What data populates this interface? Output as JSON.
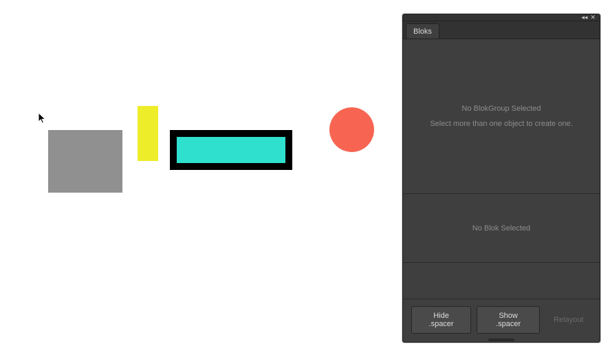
{
  "panel": {
    "tab_label": "Bloks",
    "blokgroup_empty_title": "No BlokGroup Selected",
    "blokgroup_empty_hint": "Select more than one object to create one.",
    "blok_empty_title": "No Blok Selected",
    "btn_hide": "Hide .spacer",
    "btn_show": "Show .spacer",
    "btn_relayout": "Relayout"
  },
  "shapes": {
    "gray": "#909090",
    "yellow": "#eded2a",
    "cyan": "#2fe0cf",
    "circle": "#f76552"
  }
}
